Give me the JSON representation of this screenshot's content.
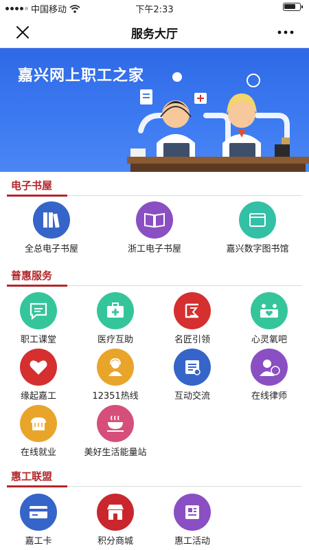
{
  "status_bar": {
    "carrier": "中国移动",
    "time": "下午2:33"
  },
  "navbar": {
    "title": "服务大厅"
  },
  "banner": {
    "title": "嘉兴网上职工之家"
  },
  "sections": {
    "ebook": {
      "title": "电子书屋",
      "items": [
        {
          "label": "全总电子书屋",
          "icon": "books-icon",
          "color": "#3565c8"
        },
        {
          "label": "浙工电子书屋",
          "icon": "open-book-icon",
          "color": "#8a4fc3"
        },
        {
          "label": "嘉兴数字图书馆",
          "icon": "book-icon",
          "color": "#33c0a6"
        }
      ]
    },
    "benefit": {
      "title": "普惠服务",
      "items": [
        {
          "label": "职工课堂",
          "icon": "chat-bubble-icon",
          "color": "#35c59b"
        },
        {
          "label": "医疗互助",
          "icon": "medical-kit-icon",
          "color": "#35c59b"
        },
        {
          "label": "名匠引领",
          "icon": "craftsman-icon",
          "color": "#d52f2f"
        },
        {
          "label": "心灵氧吧",
          "icon": "heart-people-icon",
          "color": "#35c59b"
        },
        {
          "label": "缘起嘉工",
          "icon": "heart-icon",
          "color": "#d52f2f"
        },
        {
          "label": "12351热线",
          "icon": "hotline-person-icon",
          "color": "#e9a52a"
        },
        {
          "label": "互动交流",
          "icon": "document-icon",
          "color": "#3565c8"
        },
        {
          "label": "在线律师",
          "icon": "lawyer-icon",
          "color": "#8a4fc3"
        },
        {
          "label": "在线就业",
          "icon": "bread-icon",
          "color": "#e9a52a"
        },
        {
          "label": "美好生活能量站",
          "icon": "coffee-cup-icon",
          "color": "#d64f7a"
        }
      ]
    },
    "union": {
      "title": "惠工联盟",
      "items": [
        {
          "label": "嘉工卡",
          "icon": "card-icon",
          "color": "#3565c8"
        },
        {
          "label": "积分商城",
          "icon": "shop-icon",
          "color": "#c9272d"
        },
        {
          "label": "惠工活动",
          "icon": "newspaper-icon",
          "color": "#8a4fc3"
        }
      ]
    }
  }
}
